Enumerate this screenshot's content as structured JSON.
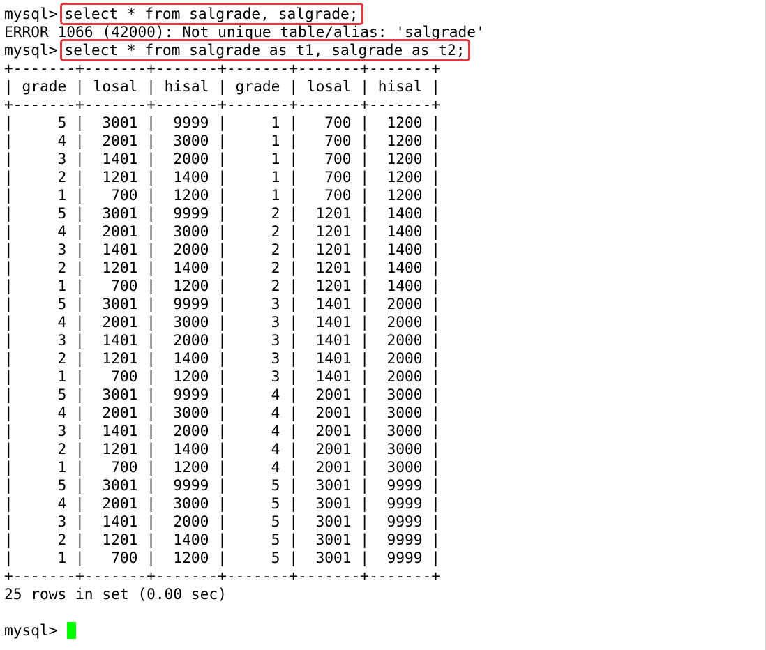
{
  "terminal": {
    "prompt": "mysql>",
    "cmd1": "select * from salgrade, salgrade;",
    "error": "ERROR 1066 (42000): Not unique table/alias: 'salgrade'",
    "cmd2": "select * from salgrade as t1, salgrade as t2;",
    "border": "+-------+-------+-------+-------+-------+-------+",
    "header": "| grade | losal | hisal | grade | losal | hisal |",
    "rows": [
      "|     5 |  3001 |  9999 |     1 |   700 |  1200 |",
      "|     4 |  2001 |  3000 |     1 |   700 |  1200 |",
      "|     3 |  1401 |  2000 |     1 |   700 |  1200 |",
      "|     2 |  1201 |  1400 |     1 |   700 |  1200 |",
      "|     1 |   700 |  1200 |     1 |   700 |  1200 |",
      "|     5 |  3001 |  9999 |     2 |  1201 |  1400 |",
      "|     4 |  2001 |  3000 |     2 |  1201 |  1400 |",
      "|     3 |  1401 |  2000 |     2 |  1201 |  1400 |",
      "|     2 |  1201 |  1400 |     2 |  1201 |  1400 |",
      "|     1 |   700 |  1200 |     2 |  1201 |  1400 |",
      "|     5 |  3001 |  9999 |     3 |  1401 |  2000 |",
      "|     4 |  2001 |  3000 |     3 |  1401 |  2000 |",
      "|     3 |  1401 |  2000 |     3 |  1401 |  2000 |",
      "|     2 |  1201 |  1400 |     3 |  1401 |  2000 |",
      "|     1 |   700 |  1200 |     3 |  1401 |  2000 |",
      "|     5 |  3001 |  9999 |     4 |  2001 |  3000 |",
      "|     4 |  2001 |  3000 |     4 |  2001 |  3000 |",
      "|     3 |  1401 |  2000 |     4 |  2001 |  3000 |",
      "|     2 |  1201 |  1400 |     4 |  2001 |  3000 |",
      "|     1 |   700 |  1200 |     4 |  2001 |  3000 |",
      "|     5 |  3001 |  9999 |     5 |  3001 |  9999 |",
      "|     4 |  2001 |  3000 |     5 |  3001 |  9999 |",
      "|     3 |  1401 |  2000 |     5 |  3001 |  9999 |",
      "|     2 |  1201 |  1400 |     5 |  3001 |  9999 |",
      "|     1 |   700 |  1200 |     5 |  3001 |  9999 |"
    ],
    "summary": "25 rows in set (0.00 sec)",
    "blank": ""
  },
  "colors": {
    "highlight_border": "#e2383f",
    "cursor": "#00ff00",
    "text": "#000000",
    "background": "#ffffff"
  }
}
